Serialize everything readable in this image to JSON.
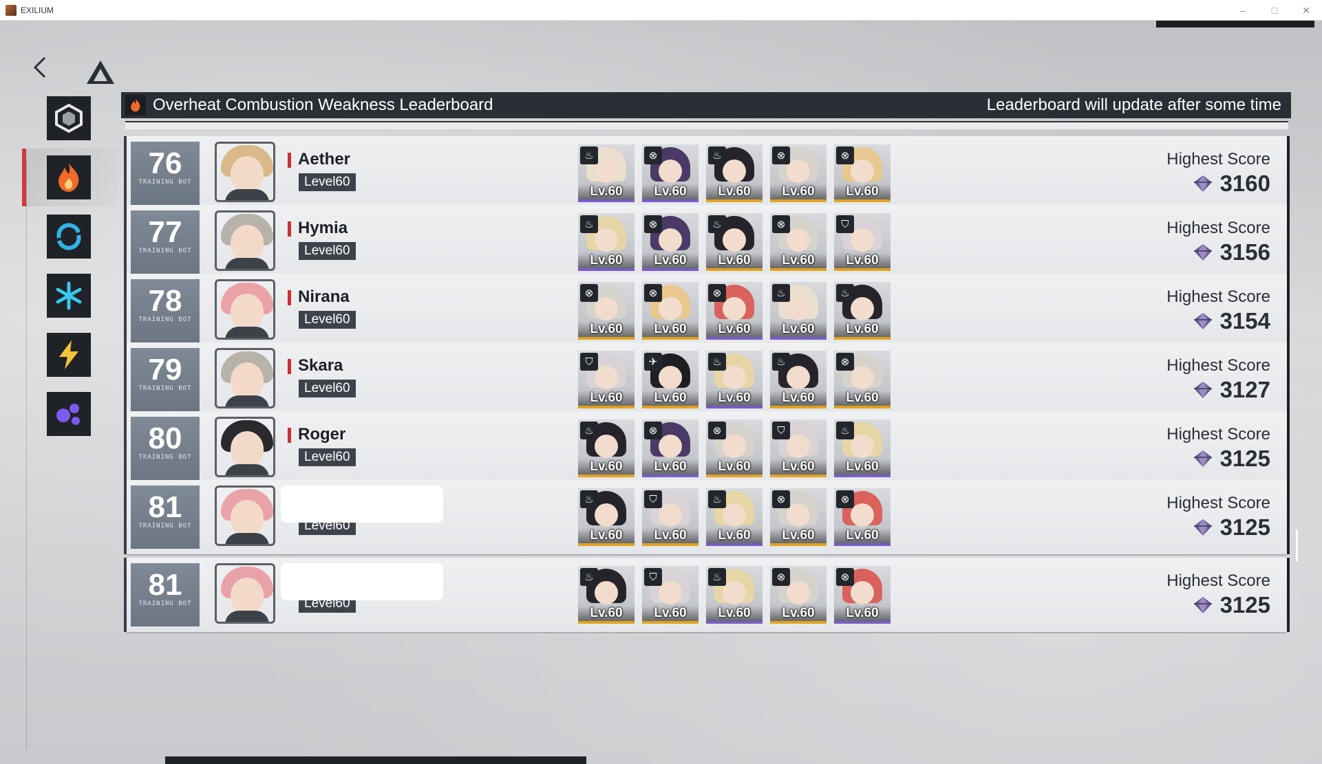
{
  "window": {
    "title": "EXILIUM"
  },
  "header": {
    "title": "Overheat Combustion Weakness Leaderboard",
    "note": "Leaderboard will update after some time"
  },
  "tabs": [
    {
      "icon": "hexagon-icon",
      "active": false
    },
    {
      "icon": "fire-icon",
      "active": true
    },
    {
      "icon": "swirl-icon",
      "active": false
    },
    {
      "icon": "snowflake-icon",
      "active": false
    },
    {
      "icon": "lightning-icon",
      "active": false
    },
    {
      "icon": "orbs-icon",
      "active": false
    }
  ],
  "rank_sub_label": "TRAINING BOT",
  "score_label": "Highest Score",
  "rows": [
    {
      "rank": "76",
      "name": "Aether",
      "level": "Level60",
      "score": "3160",
      "avatar_hair": "#d9b98a",
      "team": [
        {
          "level": "Lv.60",
          "icon": "♨",
          "hair": "#eadfcf",
          "bar": "#7a5cc7"
        },
        {
          "level": "Lv.60",
          "icon": "⊗",
          "hair": "#4b3a66",
          "bar": "#7a5cc7"
        },
        {
          "level": "Lv.60",
          "icon": "♨",
          "hair": "#26242a",
          "bar": "#e2a21c"
        },
        {
          "level": "Lv.60",
          "icon": "⊗",
          "hair": "#d6d2cc",
          "bar": "#e2a21c"
        },
        {
          "level": "Lv.60",
          "icon": "⊗",
          "hair": "#e8c88e",
          "bar": "#e2a21c"
        }
      ]
    },
    {
      "rank": "77",
      "name": "Hymia",
      "level": "Level60",
      "score": "3156",
      "avatar_hair": "#b7b2aa",
      "team": [
        {
          "level": "Lv.60",
          "icon": "♨",
          "hair": "#e6d6a6",
          "bar": "#7a5cc7"
        },
        {
          "level": "Lv.60",
          "icon": "⊗",
          "hair": "#4b3a66",
          "bar": "#7a5cc7"
        },
        {
          "level": "Lv.60",
          "icon": "♨",
          "hair": "#26242a",
          "bar": "#e2a21c"
        },
        {
          "level": "Lv.60",
          "icon": "⊗",
          "hair": "#d6d2cc",
          "bar": "#e2a21c"
        },
        {
          "level": "Lv.60",
          "icon": "⛉",
          "hair": "#d9d3d6",
          "bar": "#e2a21c"
        }
      ]
    },
    {
      "rank": "78",
      "name": "Nirana",
      "level": "Level60",
      "score": "3154",
      "avatar_hair": "#e9a3a8",
      "team": [
        {
          "level": "Lv.60",
          "icon": "⊗",
          "hair": "#d6d2cc",
          "bar": "#e2a21c"
        },
        {
          "level": "Lv.60",
          "icon": "⊗",
          "hair": "#e8c88e",
          "bar": "#e2a21c"
        },
        {
          "level": "Lv.60",
          "icon": "⊗",
          "hair": "#d9625c",
          "bar": "#7a5cc7"
        },
        {
          "level": "Lv.60",
          "icon": "♨",
          "hair": "#eadfcf",
          "bar": "#7a5cc7"
        },
        {
          "level": "Lv.60",
          "icon": "♨",
          "hair": "#26242a",
          "bar": "#e2a21c"
        }
      ]
    },
    {
      "rank": "79",
      "name": "Skara",
      "level": "Level60",
      "score": "3127",
      "avatar_hair": "#b7b2aa",
      "team": [
        {
          "level": "Lv.60",
          "icon": "⛉",
          "hair": "#d9d3d6",
          "bar": "#e2a21c"
        },
        {
          "level": "Lv.60",
          "icon": "✈",
          "hair": "#1f1e22",
          "bar": "#e2a21c"
        },
        {
          "level": "Lv.60",
          "icon": "♨",
          "hair": "#e6d6a6",
          "bar": "#7a5cc7"
        },
        {
          "level": "Lv.60",
          "icon": "♨",
          "hair": "#26242a",
          "bar": "#e2a21c"
        },
        {
          "level": "Lv.60",
          "icon": "⊗",
          "hair": "#d6d2cc",
          "bar": "#e2a21c"
        }
      ]
    },
    {
      "rank": "80",
      "name": "Roger",
      "level": "Level60",
      "score": "3125",
      "avatar_hair": "#2a2a2e",
      "team": [
        {
          "level": "Lv.60",
          "icon": "♨",
          "hair": "#26242a",
          "bar": "#e2a21c"
        },
        {
          "level": "Lv.60",
          "icon": "⊗",
          "hair": "#4b3a66",
          "bar": "#7a5cc7"
        },
        {
          "level": "Lv.60",
          "icon": "⊗",
          "hair": "#d6d2cc",
          "bar": "#e2a21c"
        },
        {
          "level": "Lv.60",
          "icon": "⛉",
          "hair": "#d9d3d6",
          "bar": "#e2a21c"
        },
        {
          "level": "Lv.60",
          "icon": "♨",
          "hair": "#e6d6a6",
          "bar": "#7a5cc7"
        }
      ]
    },
    {
      "rank": "81",
      "name": "",
      "level": "Level60",
      "score": "3125",
      "avatar_hair": "#e9a3a8",
      "team": [
        {
          "level": "Lv.60",
          "icon": "♨",
          "hair": "#26242a",
          "bar": "#e2a21c"
        },
        {
          "level": "Lv.60",
          "icon": "⛉",
          "hair": "#d9d3d6",
          "bar": "#e2a21c"
        },
        {
          "level": "Lv.60",
          "icon": "♨",
          "hair": "#e6d6a6",
          "bar": "#7a5cc7"
        },
        {
          "level": "Lv.60",
          "icon": "⊗",
          "hair": "#d6d2cc",
          "bar": "#e2a21c"
        },
        {
          "level": "Lv.60",
          "icon": "⊗",
          "hair": "#d9625c",
          "bar": "#7a5cc7"
        }
      ]
    },
    {
      "rank": "81",
      "name": "",
      "level": "Level60",
      "score": "3125",
      "avatar_hair": "#e9a3a8",
      "team": [
        {
          "level": "Lv.60",
          "icon": "♨",
          "hair": "#26242a",
          "bar": "#e2a21c"
        },
        {
          "level": "Lv.60",
          "icon": "⛉",
          "hair": "#d9d3d6",
          "bar": "#e2a21c"
        },
        {
          "level": "Lv.60",
          "icon": "♨",
          "hair": "#e6d6a6",
          "bar": "#7a5cc7"
        },
        {
          "level": "Lv.60",
          "icon": "⊗",
          "hair": "#d6d2cc",
          "bar": "#e2a21c"
        },
        {
          "level": "Lv.60",
          "icon": "⊗",
          "hair": "#d9625c",
          "bar": "#7a5cc7"
        }
      ]
    }
  ]
}
